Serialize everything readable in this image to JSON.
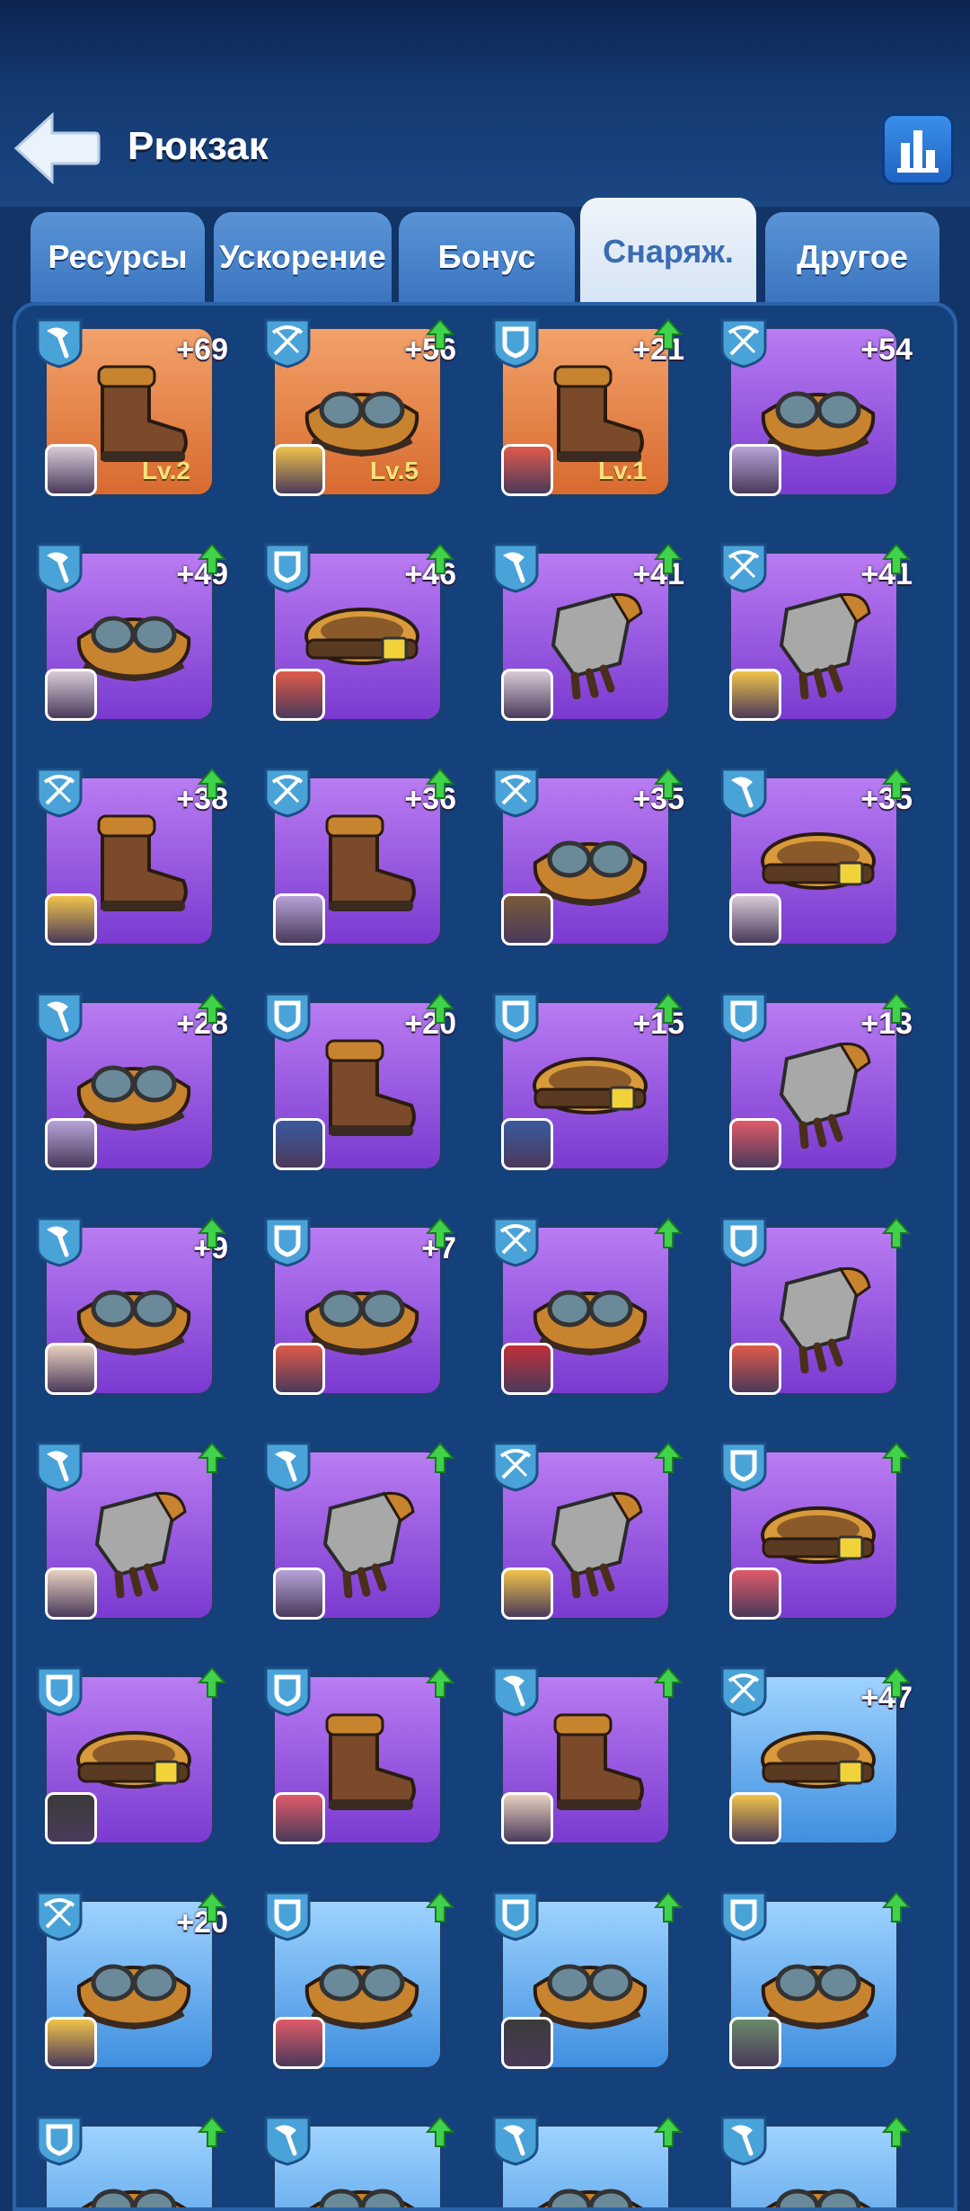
{
  "header": {
    "title": "Рюкзак",
    "back_icon": "back-arrow-icon",
    "stats_icon": "bar-chart-icon"
  },
  "tabs": [
    {
      "label": "Ресурсы",
      "active": false
    },
    {
      "label": "Ускорение",
      "active": false
    },
    {
      "label": "Бонус",
      "active": false
    },
    {
      "label": "Снаряж.",
      "active": true
    },
    {
      "label": "Другое",
      "active": false
    }
  ],
  "colors": {
    "orange": "#e07a3a",
    "purple": "#9a55e0",
    "blue": "#5aa8f0",
    "upgrade": "#3fd24a",
    "level_text": "#f7e27a"
  },
  "items": [
    {
      "type": "pickaxe",
      "gear": "boot",
      "rarity": "orange",
      "level": "+69",
      "lv": "Lv.2",
      "upgrade": false,
      "avatar": "#d9cbd8"
    },
    {
      "type": "crossbow",
      "gear": "goggles",
      "rarity": "orange",
      "level": "+56",
      "lv": "Lv.5",
      "upgrade": true,
      "avatar": "#f1c34a"
    },
    {
      "type": "shield",
      "gear": "boot",
      "rarity": "orange",
      "level": "+21",
      "lv": "Lv.1",
      "upgrade": true,
      "avatar": "#e05a4a"
    },
    {
      "type": "crossbow",
      "gear": "goggles",
      "rarity": "purple",
      "level": "+54",
      "lv": "",
      "upgrade": false,
      "avatar": "#b7a3d8"
    },
    {
      "type": "pickaxe",
      "gear": "goggles",
      "rarity": "purple",
      "level": "+49",
      "lv": "",
      "upgrade": true,
      "avatar": "#d9cbd8"
    },
    {
      "type": "shield",
      "gear": "belt",
      "rarity": "purple",
      "level": "+46",
      "lv": "",
      "upgrade": true,
      "avatar": "#e05a4a"
    },
    {
      "type": "pickaxe",
      "gear": "glove",
      "rarity": "purple",
      "level": "+41",
      "lv": "",
      "upgrade": true,
      "avatar": "#d9cbd8"
    },
    {
      "type": "crossbow",
      "gear": "glove",
      "rarity": "purple",
      "level": "+41",
      "lv": "",
      "upgrade": true,
      "avatar": "#f1c34a"
    },
    {
      "type": "crossbow",
      "gear": "boot",
      "rarity": "purple",
      "level": "+38",
      "lv": "",
      "upgrade": true,
      "avatar": "#f1c34a"
    },
    {
      "type": "crossbow",
      "gear": "boot",
      "rarity": "purple",
      "level": "+36",
      "lv": "",
      "upgrade": true,
      "avatar": "#b7a3d8"
    },
    {
      "type": "crossbow",
      "gear": "goggles",
      "rarity": "purple",
      "level": "+35",
      "lv": "",
      "upgrade": true,
      "avatar": "#7a5a3a"
    },
    {
      "type": "pickaxe",
      "gear": "belt",
      "rarity": "purple",
      "level": "+35",
      "lv": "",
      "upgrade": true,
      "avatar": "#d9cbd8"
    },
    {
      "type": "pickaxe",
      "gear": "goggles",
      "rarity": "purple",
      "level": "+28",
      "lv": "",
      "upgrade": true,
      "avatar": "#b7a3d8"
    },
    {
      "type": "shield",
      "gear": "boot",
      "rarity": "purple",
      "level": "+20",
      "lv": "",
      "upgrade": true,
      "avatar": "#3a5aa0"
    },
    {
      "type": "shield",
      "gear": "belt",
      "rarity": "purple",
      "level": "+15",
      "lv": "",
      "upgrade": true,
      "avatar": "#3a5aa0"
    },
    {
      "type": "shield",
      "gear": "glove",
      "rarity": "purple",
      "level": "+13",
      "lv": "",
      "upgrade": true,
      "avatar": "#e05a6a"
    },
    {
      "type": "pickaxe",
      "gear": "goggles",
      "rarity": "purple",
      "level": "+9",
      "lv": "",
      "upgrade": true,
      "avatar": "#e8d0c0"
    },
    {
      "type": "shield",
      "gear": "goggles",
      "rarity": "purple",
      "level": "+7",
      "lv": "",
      "upgrade": true,
      "avatar": "#e05a4a"
    },
    {
      "type": "crossbow",
      "gear": "goggles",
      "rarity": "purple",
      "level": "",
      "lv": "",
      "upgrade": true,
      "avatar": "#c0303a"
    },
    {
      "type": "shield",
      "gear": "glove",
      "rarity": "purple",
      "level": "",
      "lv": "",
      "upgrade": true,
      "avatar": "#e05a4a"
    },
    {
      "type": "pickaxe",
      "gear": "glove",
      "rarity": "purple",
      "level": "",
      "lv": "",
      "upgrade": true,
      "avatar": "#e8d0c0"
    },
    {
      "type": "pickaxe",
      "gear": "glove",
      "rarity": "purple",
      "level": "",
      "lv": "",
      "upgrade": true,
      "avatar": "#b7a3d8"
    },
    {
      "type": "crossbow",
      "gear": "glove",
      "rarity": "purple",
      "level": "",
      "lv": "",
      "upgrade": true,
      "avatar": "#f1c34a"
    },
    {
      "type": "shield",
      "gear": "belt",
      "rarity": "purple",
      "level": "",
      "lv": "",
      "upgrade": true,
      "avatar": "#e05a6a"
    },
    {
      "type": "shield",
      "gear": "belt",
      "rarity": "purple",
      "level": "",
      "lv": "",
      "upgrade": true,
      "avatar": "#3a3a3a"
    },
    {
      "type": "shield",
      "gear": "boot",
      "rarity": "purple",
      "level": "",
      "lv": "",
      "upgrade": true,
      "avatar": "#e05a6a"
    },
    {
      "type": "pickaxe",
      "gear": "boot",
      "rarity": "purple",
      "level": "",
      "lv": "",
      "upgrade": true,
      "avatar": "#e8d0c0"
    },
    {
      "type": "crossbow",
      "gear": "belt",
      "rarity": "blue",
      "level": "+47",
      "lv": "",
      "upgrade": true,
      "avatar": "#f1c34a"
    },
    {
      "type": "crossbow",
      "gear": "goggles",
      "rarity": "blue",
      "level": "+20",
      "lv": "",
      "upgrade": true,
      "avatar": "#f1c34a"
    },
    {
      "type": "shield",
      "gear": "goggles",
      "rarity": "blue",
      "level": "",
      "lv": "",
      "upgrade": true,
      "avatar": "#e05a6a"
    },
    {
      "type": "shield",
      "gear": "goggles",
      "rarity": "blue",
      "level": "",
      "lv": "",
      "upgrade": true,
      "avatar": "#3a3a3a"
    },
    {
      "type": "shield",
      "gear": "goggles",
      "rarity": "blue",
      "level": "",
      "lv": "",
      "upgrade": true,
      "avatar": "#6a8a6a"
    },
    {
      "type": "shield",
      "gear": "goggles",
      "rarity": "blue",
      "level": "",
      "lv": "",
      "upgrade": true,
      "avatar": "#888888"
    },
    {
      "type": "pickaxe",
      "gear": "goggles",
      "rarity": "blue",
      "level": "",
      "lv": "",
      "upgrade": true,
      "avatar": "#888888"
    },
    {
      "type": "pickaxe",
      "gear": "goggles",
      "rarity": "blue",
      "level": "",
      "lv": "",
      "upgrade": true,
      "avatar": "#888888"
    },
    {
      "type": "pickaxe",
      "gear": "goggles",
      "rarity": "blue",
      "level": "",
      "lv": "",
      "upgrade": true,
      "avatar": "#888888"
    }
  ]
}
